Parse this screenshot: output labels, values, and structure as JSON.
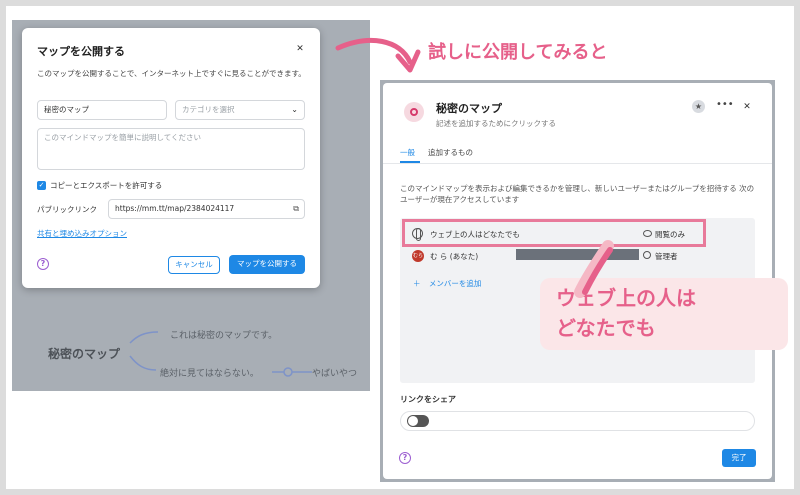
{
  "colors": {
    "accent": "#1e88e5",
    "annotation": "#e6608a",
    "callout_bg": "#fbe6e8",
    "overlay": "#a8aeb5"
  },
  "annotations": {
    "top": "試しに公開してみると",
    "callout_line1": "ウェブ上の人は",
    "callout_line2": "どなたでも"
  },
  "background_map": {
    "title": "秘密のマップ",
    "branch1": "これは秘密のマップです。",
    "branch2": "絶対に見てはならない。",
    "branch3": "やばいやつ"
  },
  "publish_dialog": {
    "title": "マップを公開する",
    "close_icon": "close-icon",
    "description": "このマップを公開することで、インターネット上ですぐに見ることができます。",
    "name_value": "秘密のマップ",
    "category_placeholder": "カテゴリを選択",
    "description_placeholder": "このマインドマップを簡単に説明してください",
    "allow_copy_label": "コピーとエクスポートを許可する",
    "allow_copy_checked": true,
    "public_link_label": "パブリックリンク",
    "public_link_value": "https://mm.tt/map/2384024117",
    "embed_link": "共有と埋め込みオプション",
    "cancel_label": "キャンセル",
    "publish_label": "マップを公開する"
  },
  "share_dialog": {
    "title": "秘密のマップ",
    "subtitle": "記述を追加するためにクリックする",
    "tabs": [
      {
        "label": "一般",
        "active": true
      },
      {
        "label": "追加するもの",
        "active": false
      }
    ],
    "description": "このマインドマップを表示および編集できるかを管理し、新しいユーザーまたはグループを招待する 次のユーザーが現在アクセスしています",
    "rows": [
      {
        "icon": "globe-icon",
        "name": "ウェブ上の人はどなたでも",
        "role": "閲覧のみ",
        "role_icon": "eye-icon"
      },
      {
        "icon": "avatar",
        "avatar_text": "むら",
        "name": "む ら (あなた)",
        "role": "管理者",
        "role_icon": "admin-icon"
      }
    ],
    "add_member": "メンバーを追加",
    "share_link_label": "リンクをシェア",
    "share_link_enabled": false,
    "done_label": "完了"
  }
}
